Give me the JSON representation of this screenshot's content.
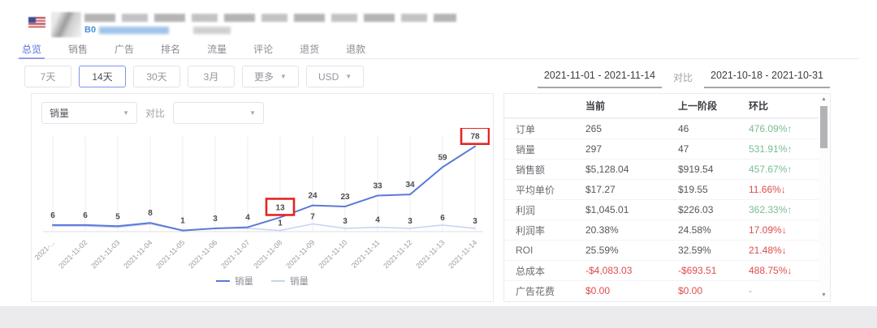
{
  "colors": {
    "accent": "#5a6fd8",
    "link_blue": "#4a90d9",
    "green": "#79bd92",
    "red": "#e04c4c",
    "chart_line": "#5b79d8",
    "chart_compare": "#c7d1f3",
    "annotation_red": "#e42525"
  },
  "header": {
    "asin_prefix": "B0"
  },
  "tabs": {
    "items": [
      "总览",
      "销售",
      "广告",
      "排名",
      "流量",
      "评论",
      "退货",
      "退款"
    ],
    "active_index": 0
  },
  "filters": {
    "ranges": [
      "7天",
      "14天",
      "30天",
      "3月"
    ],
    "active": "14天",
    "more_label": "更多",
    "currency_label": "USD"
  },
  "dates": {
    "current": "2021-11-01 - 2021-11-14",
    "vs_label": "对比",
    "previous": "2021-10-18 - 2021-10-31"
  },
  "chart_controls": {
    "metric_selected": "销量",
    "vs_label": "对比",
    "compare_selected": ""
  },
  "chart_data": {
    "type": "line",
    "title": "",
    "xlabel": "",
    "ylabel": "",
    "ylim": [
      0,
      85
    ],
    "grid": "vertical",
    "legend_position": "bottom",
    "categories": [
      "2021-...",
      "2021-11-02",
      "2021-11-03",
      "2021-11-04",
      "2021-11-05",
      "2021-11-06",
      "2021-11-07",
      "2021-11-08",
      "2021-11-09",
      "2021-11-10",
      "2021-11-11",
      "2021-11-12",
      "2021-11-13",
      "2021-11-14"
    ],
    "series": [
      {
        "name": "销量",
        "color": "#5b79d8",
        "width": 2,
        "values": [
          6,
          6,
          5,
          8,
          1,
          3,
          4,
          13,
          24,
          23,
          33,
          34,
          59,
          78
        ],
        "labels": [
          6,
          6,
          5,
          8,
          1,
          3,
          4,
          13,
          24,
          23,
          33,
          34,
          59,
          78
        ]
      },
      {
        "name": "销量",
        "color": "#c7d1f3",
        "width": 1.5,
        "values": [
          5,
          5,
          4,
          7,
          1,
          3,
          3,
          1,
          7,
          3,
          4,
          3,
          6,
          3
        ],
        "labels": [
          null,
          null,
          null,
          null,
          null,
          null,
          null,
          1,
          7,
          3,
          4,
          3,
          6,
          3
        ]
      }
    ],
    "annotated_indices": [
      7,
      13
    ]
  },
  "table": {
    "headers": [
      "",
      "当前",
      "上一阶段",
      "环比"
    ],
    "rows": [
      {
        "label": "订单",
        "current": "265",
        "previous": "46",
        "change": "476.09%↑",
        "change_color": "green",
        "value_color": "normal"
      },
      {
        "label": "销量",
        "current": "297",
        "previous": "47",
        "change": "531.91%↑",
        "change_color": "green",
        "value_color": "normal"
      },
      {
        "label": "销售额",
        "current": "$5,128.04",
        "previous": "$919.54",
        "change": "457.67%↑",
        "change_color": "green",
        "value_color": "normal"
      },
      {
        "label": "平均单价",
        "current": "$17.27",
        "previous": "$19.55",
        "change": "11.66%↓",
        "change_color": "red",
        "value_color": "normal"
      },
      {
        "label": "利润",
        "current": "$1,045.01",
        "previous": "$226.03",
        "change": "362.33%↑",
        "change_color": "green",
        "value_color": "normal"
      },
      {
        "label": "利润率",
        "current": "20.38%",
        "previous": "24.58%",
        "change": "17.09%↓",
        "change_color": "red",
        "value_color": "normal"
      },
      {
        "label": "ROI",
        "current": "25.59%",
        "previous": "32.59%",
        "change": "21.48%↓",
        "change_color": "red",
        "value_color": "normal"
      },
      {
        "label": "总成本",
        "current": "-$4,083.03",
        "previous": "-$693.51",
        "change": "488.75%↓",
        "change_color": "red",
        "value_color": "red"
      },
      {
        "label": "广告花费",
        "current": "$0.00",
        "previous": "$0.00",
        "change": "-",
        "change_color": "gray",
        "value_color": "red"
      }
    ]
  }
}
